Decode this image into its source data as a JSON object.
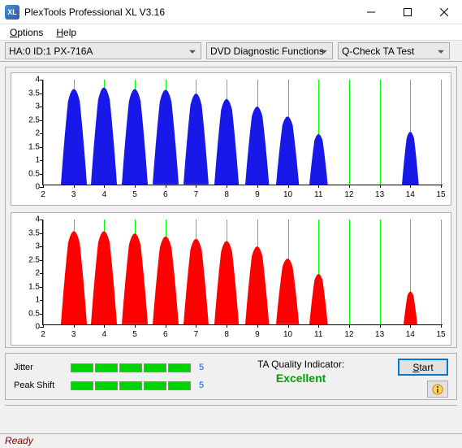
{
  "window": {
    "title": "PlexTools Professional XL V3.16"
  },
  "menu": {
    "options": "Options",
    "help": "Help"
  },
  "toolbar": {
    "drive": "HA:0 ID:1   PX-716A",
    "category": "DVD Diagnostic Functions",
    "test": "Q-Check TA Test"
  },
  "chart_data": [
    {
      "type": "peaks",
      "color": "#1818e8",
      "ylim": [
        0,
        4
      ],
      "xlim": [
        2,
        15
      ],
      "yticks": [
        0,
        0.5,
        1,
        1.5,
        2,
        2.5,
        3,
        3.5,
        4
      ],
      "xticks": [
        2,
        3,
        4,
        5,
        6,
        7,
        8,
        9,
        10,
        11,
        12,
        13,
        14,
        15
      ],
      "peaks": [
        {
          "x": 3,
          "h": 3.8,
          "w": 0.85
        },
        {
          "x": 4,
          "h": 3.85,
          "w": 0.85
        },
        {
          "x": 5,
          "h": 3.8,
          "w": 0.85
        },
        {
          "x": 6,
          "h": 3.75,
          "w": 0.85
        },
        {
          "x": 7,
          "h": 3.6,
          "w": 0.82
        },
        {
          "x": 8,
          "h": 3.4,
          "w": 0.8
        },
        {
          "x": 9,
          "h": 3.1,
          "w": 0.78
        },
        {
          "x": 10,
          "h": 2.7,
          "w": 0.75
        },
        {
          "x": 11,
          "h": 2.0,
          "w": 0.6
        },
        {
          "x": 14,
          "h": 2.1,
          "w": 0.55
        }
      ]
    },
    {
      "type": "peaks",
      "color": "#ff0000",
      "ylim": [
        0,
        4
      ],
      "xlim": [
        2,
        15
      ],
      "yticks": [
        0,
        0.5,
        1,
        1.5,
        2,
        2.5,
        3,
        3.5,
        4
      ],
      "xticks": [
        2,
        3,
        4,
        5,
        6,
        7,
        8,
        9,
        10,
        11,
        12,
        13,
        14,
        15
      ],
      "peaks": [
        {
          "x": 3,
          "h": 3.7,
          "w": 0.85
        },
        {
          "x": 4,
          "h": 3.7,
          "w": 0.85
        },
        {
          "x": 5,
          "h": 3.6,
          "w": 0.85
        },
        {
          "x": 6,
          "h": 3.5,
          "w": 0.85
        },
        {
          "x": 7,
          "h": 3.4,
          "w": 0.82
        },
        {
          "x": 8,
          "h": 3.3,
          "w": 0.8
        },
        {
          "x": 9,
          "h": 3.1,
          "w": 0.78
        },
        {
          "x": 10,
          "h": 2.6,
          "w": 0.75
        },
        {
          "x": 11,
          "h": 2.0,
          "w": 0.6
        },
        {
          "x": 14,
          "h": 1.3,
          "w": 0.45
        }
      ]
    }
  ],
  "metrics": {
    "jitter_label": "Jitter",
    "jitter_value": "5",
    "jitter_bars": 5,
    "peakshift_label": "Peak Shift",
    "peakshift_value": "5",
    "peakshift_bars": 5
  },
  "quality": {
    "label": "TA Quality Indicator:",
    "value": "Excellent"
  },
  "buttons": {
    "start": "Start"
  },
  "status": "Ready"
}
